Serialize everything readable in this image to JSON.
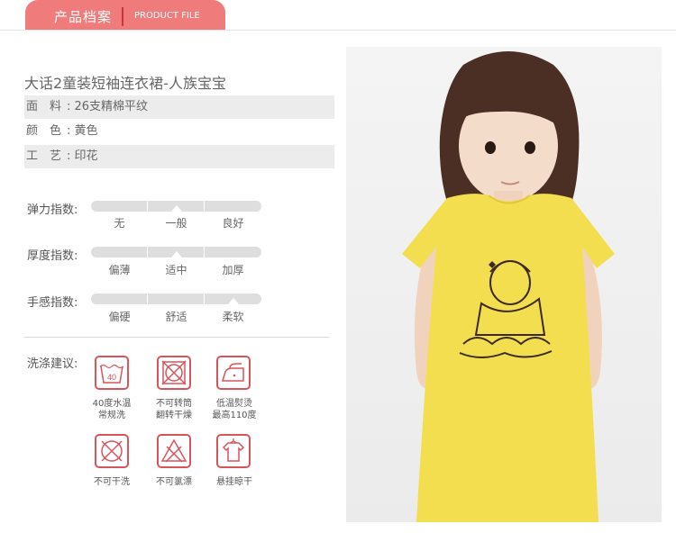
{
  "header": {
    "title_cn": "产品档案",
    "title_en": "PRODUCT FILE"
  },
  "product": {
    "title": "大话2童装短袖连衣裙-人族宝宝",
    "attributes": [
      {
        "label": "面　料",
        "value": ": 26支精棉平纹"
      },
      {
        "label": "颜　色",
        "value": ": 黄色"
      },
      {
        "label": "工　艺",
        "value": ": 印花"
      }
    ]
  },
  "indices": [
    {
      "label": "弹力指数:",
      "options": [
        "无",
        "一般",
        "良好"
      ],
      "selected": 1
    },
    {
      "label": "厚度指数:",
      "options": [
        "偏薄",
        "适中",
        "加厚"
      ],
      "selected": 1
    },
    {
      "label": "手感指数:",
      "options": [
        "偏硬",
        "舒适",
        "柔软"
      ],
      "selected": 2
    }
  ],
  "care": {
    "title": "洗涤建议:",
    "items": [
      {
        "icon": "wash-40-icon",
        "line1": "40度水温",
        "line2": "常规洗",
        "symbol": "40"
      },
      {
        "icon": "no-tumble-dry-icon",
        "line1": "不可转筒",
        "line2": "翻转干燥"
      },
      {
        "icon": "iron-low-icon",
        "line1": "低温熨烫",
        "line2": "最高110度"
      },
      {
        "icon": "no-dry-clean-icon",
        "line1": "不可干洗",
        "line2": ""
      },
      {
        "icon": "no-bleach-icon",
        "line1": "不可氯漂",
        "line2": ""
      },
      {
        "icon": "hang-dry-icon",
        "line1": "悬挂晾干",
        "line2": ""
      }
    ]
  },
  "colors": {
    "accent": "#f07b7b",
    "icon_red": "#d9545a",
    "dress_yellow": "#f3de4f"
  }
}
